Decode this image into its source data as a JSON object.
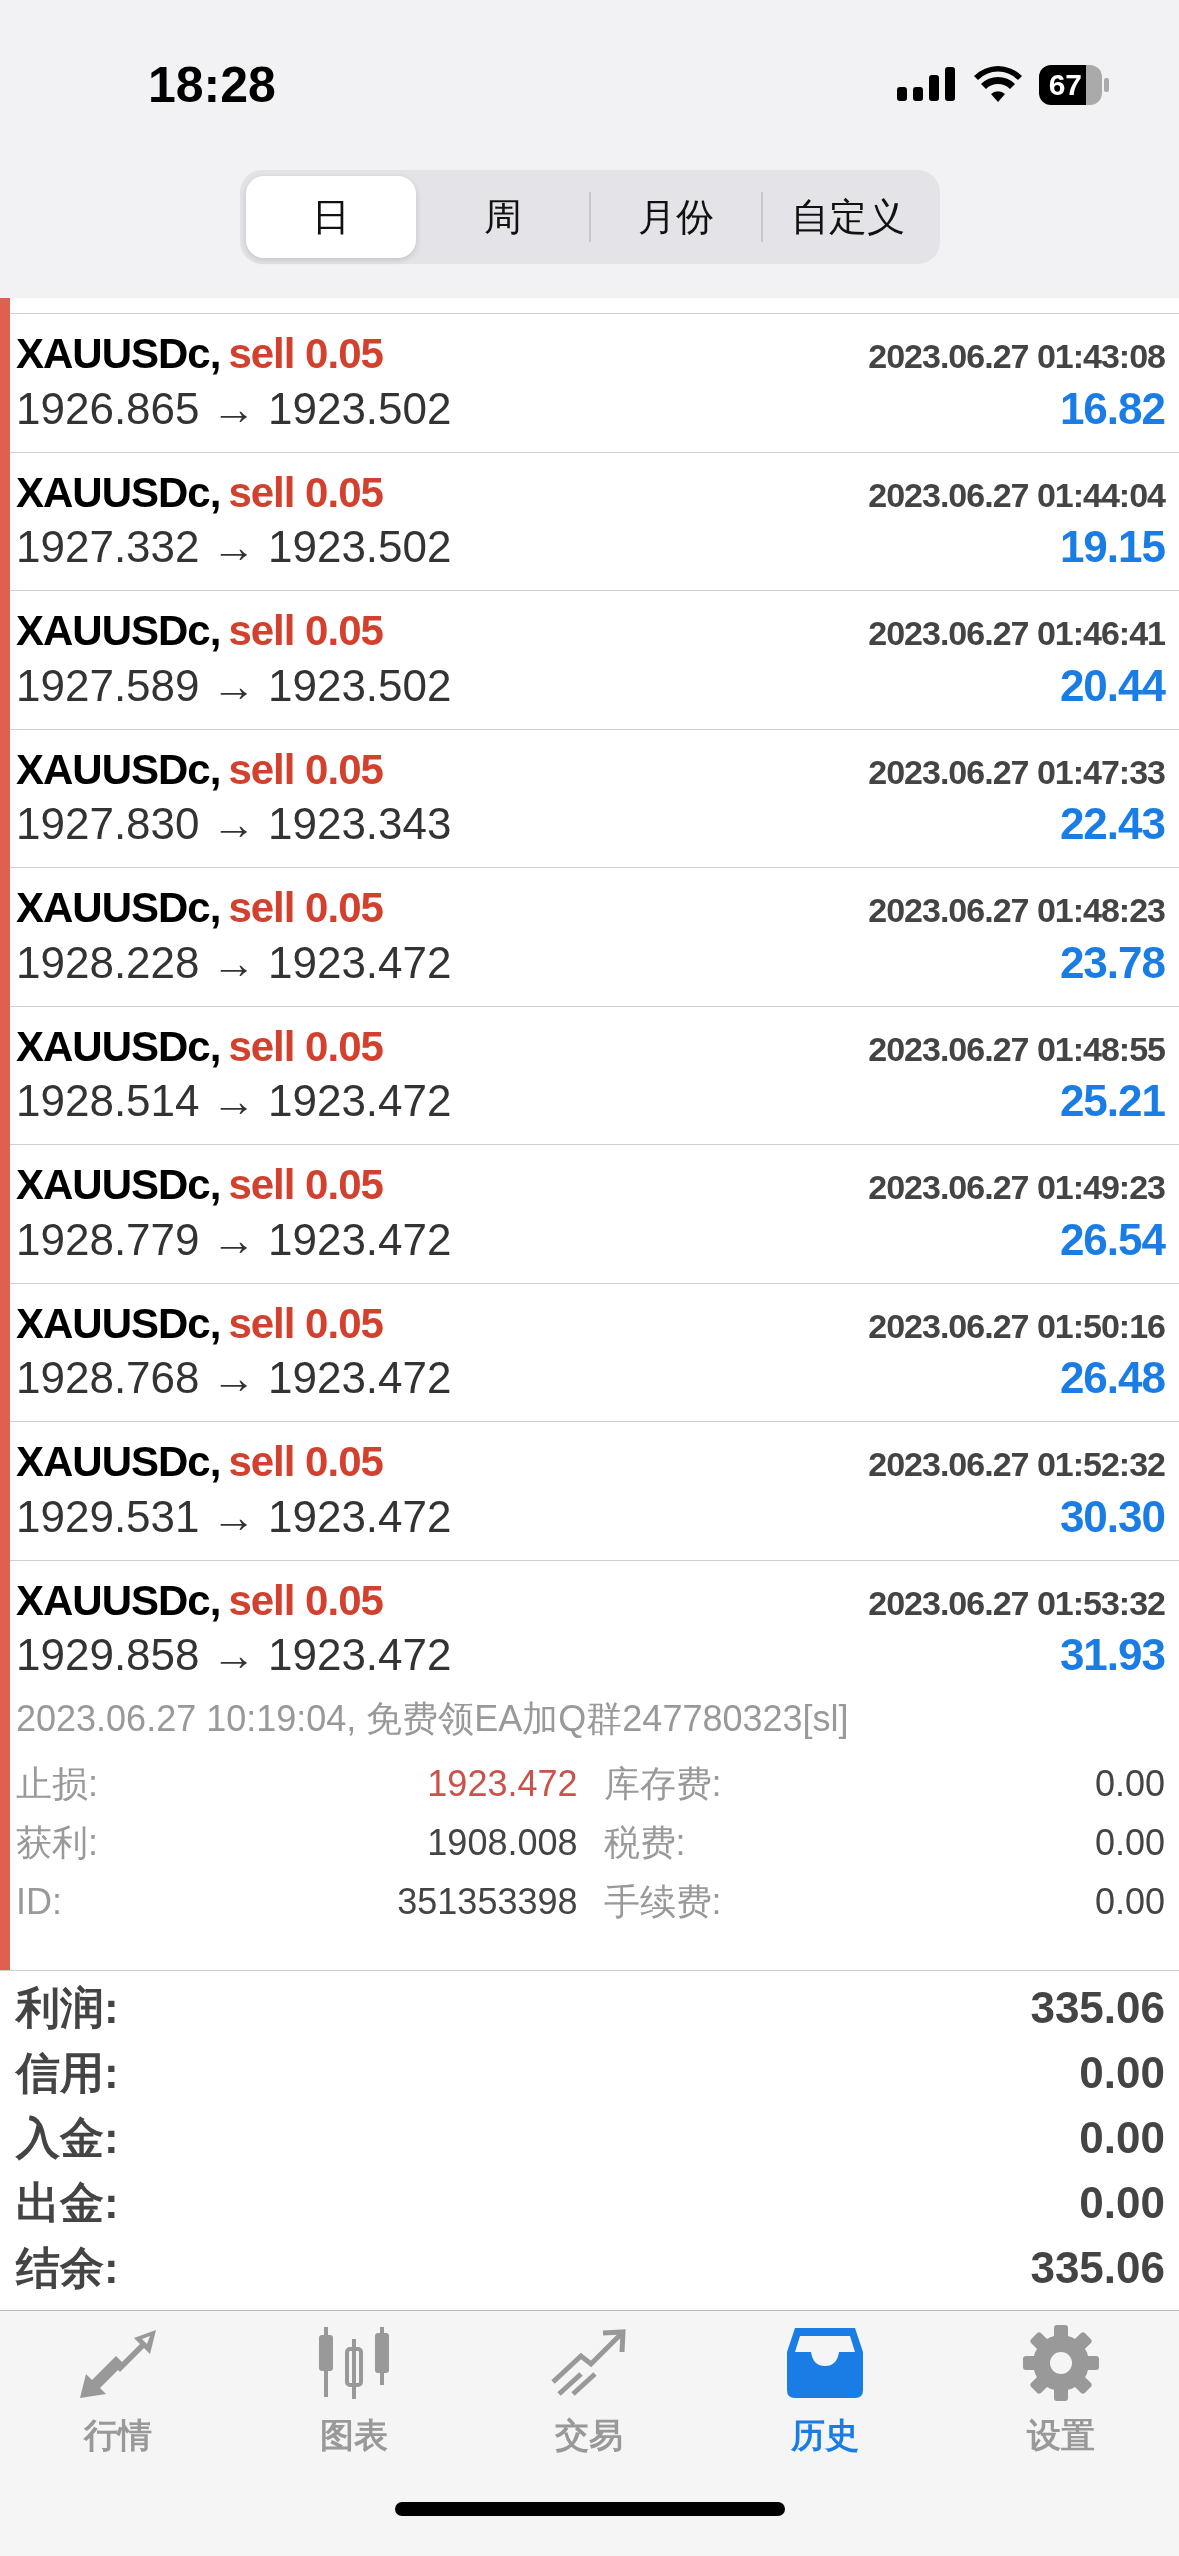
{
  "status_bar": {
    "time": "18:28",
    "battery": "67"
  },
  "period_tabs": [
    {
      "label": "日",
      "selected": true
    },
    {
      "label": "周",
      "selected": false
    },
    {
      "label": "月份",
      "selected": false
    },
    {
      "label": "自定义",
      "selected": false
    }
  ],
  "deals": [
    {
      "symbol": "XAUUSDc,",
      "order": "sell 0.05",
      "time": "2023.06.27 01:43:08",
      "prices": "1926.865 → 1923.502",
      "profit": "16.82"
    },
    {
      "symbol": "XAUUSDc,",
      "order": "sell 0.05",
      "time": "2023.06.27 01:44:04",
      "prices": "1927.332 → 1923.502",
      "profit": "19.15"
    },
    {
      "symbol": "XAUUSDc,",
      "order": "sell 0.05",
      "time": "2023.06.27 01:46:41",
      "prices": "1927.589 → 1923.502",
      "profit": "20.44"
    },
    {
      "symbol": "XAUUSDc,",
      "order": "sell 0.05",
      "time": "2023.06.27 01:47:33",
      "prices": "1927.830 → 1923.343",
      "profit": "22.43"
    },
    {
      "symbol": "XAUUSDc,",
      "order": "sell 0.05",
      "time": "2023.06.27 01:48:23",
      "prices": "1928.228 → 1923.472",
      "profit": "23.78"
    },
    {
      "symbol": "XAUUSDc,",
      "order": "sell 0.05",
      "time": "2023.06.27 01:48:55",
      "prices": "1928.514 → 1923.472",
      "profit": "25.21"
    },
    {
      "symbol": "XAUUSDc,",
      "order": "sell 0.05",
      "time": "2023.06.27 01:49:23",
      "prices": "1928.779 → 1923.472",
      "profit": "26.54"
    },
    {
      "symbol": "XAUUSDc,",
      "order": "sell 0.05",
      "time": "2023.06.27 01:50:16",
      "prices": "1928.768 → 1923.472",
      "profit": "26.48"
    },
    {
      "symbol": "XAUUSDc,",
      "order": "sell 0.05",
      "time": "2023.06.27 01:52:32",
      "prices": "1929.531 → 1923.472",
      "profit": "30.30"
    },
    {
      "symbol": "XAUUSDc,",
      "order": "sell 0.05",
      "time": "2023.06.27 01:53:32",
      "prices": "1929.858 → 1923.472",
      "profit": "31.93",
      "details": {
        "comment": "2023.06.27 10:19:04, 免费领EA加Q群247780323[sl]",
        "fields": [
          {
            "label": "止损:",
            "value": "1923.472",
            "kind": "stop"
          },
          {
            "label": "库存费:",
            "value": "0.00",
            "kind": "plain"
          },
          {
            "label": "获利:",
            "value": "1908.008",
            "kind": "plain"
          },
          {
            "label": "税费:",
            "value": "0.00",
            "kind": "plain"
          },
          {
            "label": "ID:",
            "value": "351353398",
            "kind": "plain"
          },
          {
            "label": "手续费:",
            "value": "0.00",
            "kind": "plain"
          }
        ]
      }
    }
  ],
  "summary": [
    {
      "label": "利润:",
      "value": "335.06"
    },
    {
      "label": "信用:",
      "value": "0.00"
    },
    {
      "label": "入金:",
      "value": "0.00"
    },
    {
      "label": "出金:",
      "value": "0.00"
    },
    {
      "label": "结余:",
      "value": "335.06"
    }
  ],
  "tab_bar": [
    {
      "label": "行情",
      "selected": false
    },
    {
      "label": "图表",
      "selected": false
    },
    {
      "label": "交易",
      "selected": false
    },
    {
      "label": "历史",
      "selected": true
    },
    {
      "label": "设置",
      "selected": false
    }
  ]
}
